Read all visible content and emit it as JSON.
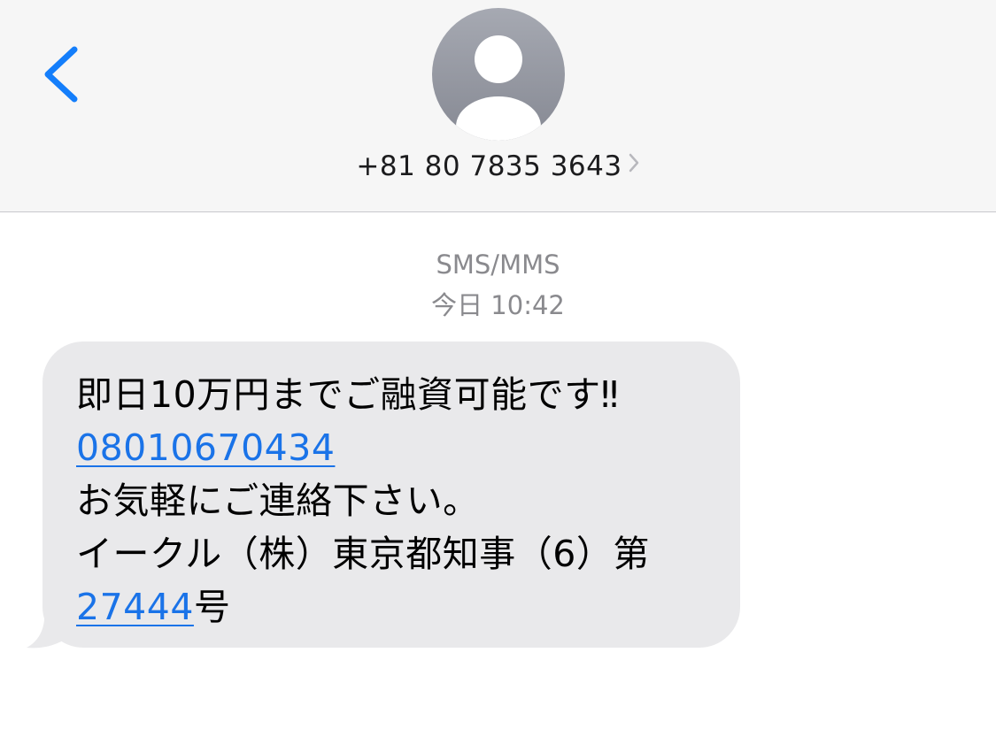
{
  "header": {
    "contact_number": "+81 80 7835 3643",
    "back_icon": "chevron-left-icon",
    "avatar_icon": "person-avatar-icon",
    "details_icon": "chevron-right-icon"
  },
  "conversation": {
    "service_label": "SMS/MMS",
    "timestamp": "今日 10:42"
  },
  "message": {
    "line1": "即日10万円までご融資可能です‼",
    "phone_link": "08010670434",
    "line3": "お気軽にご連絡下さい。",
    "line4": "イークル（株）東京都知事（6）第",
    "license_link": "27444",
    "license_suffix": "号"
  },
  "colors": {
    "accent": "#1a73e8",
    "bubble": "#e9e9eb",
    "header_bg": "#f6f6f6",
    "secondary_text": "#8a8a8e"
  }
}
